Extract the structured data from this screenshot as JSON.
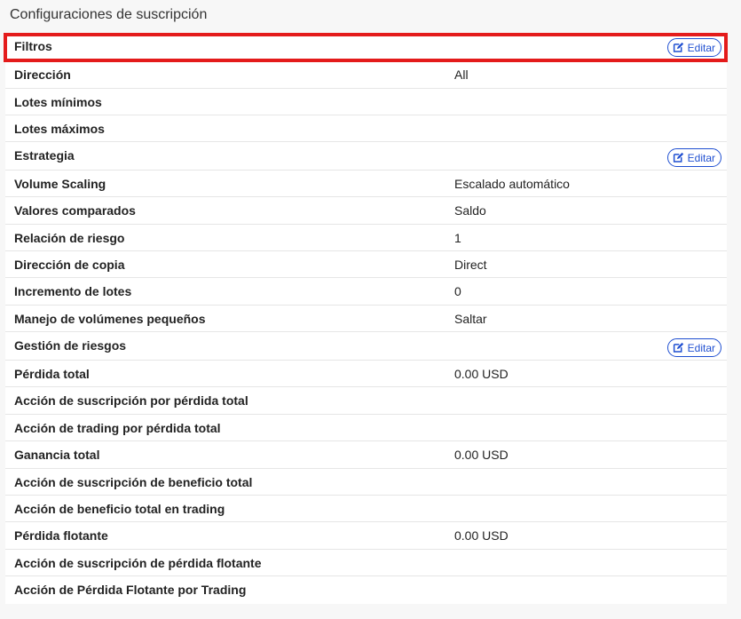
{
  "page": {
    "title": "Configuraciones de suscripción"
  },
  "sections": {
    "filters": {
      "title": "Filtros",
      "edit_label": "Editar",
      "rows": [
        {
          "label": "Dirección",
          "value": "All"
        },
        {
          "label": "Lotes mínimos",
          "value": ""
        },
        {
          "label": "Lotes máximos",
          "value": ""
        }
      ]
    },
    "strategy": {
      "title": "Estrategia",
      "edit_label": "Editar",
      "rows": [
        {
          "label": "Volume Scaling",
          "value": "Escalado automático"
        },
        {
          "label": "Valores comparados",
          "value": "Saldo"
        },
        {
          "label": "Relación de riesgo",
          "value": "1"
        },
        {
          "label": "Dirección de copia",
          "value": "Direct"
        },
        {
          "label": "Incremento de lotes",
          "value": "0"
        },
        {
          "label": "Manejo de volúmenes pequeños",
          "value": "Saltar"
        }
      ]
    },
    "risk": {
      "title": "Gestión de riesgos",
      "edit_label": "Editar",
      "rows": [
        {
          "label": "Pérdida total",
          "value": "0.00 USD"
        },
        {
          "label": "Acción de suscripción por pérdida total",
          "value": ""
        },
        {
          "label": "Acción de trading por pérdida total",
          "value": ""
        },
        {
          "label": "Ganancia total",
          "value": "0.00 USD"
        },
        {
          "label": "Acción de suscripción de beneficio total",
          "value": ""
        },
        {
          "label": "Acción de beneficio total en trading",
          "value": ""
        },
        {
          "label": "Pérdida flotante",
          "value": "0.00 USD"
        },
        {
          "label": "Acción de suscripción de pérdida flotante",
          "value": ""
        },
        {
          "label": "Acción de Pérdida Flotante por Trading",
          "value": ""
        }
      ]
    }
  },
  "colors": {
    "accent": "#1f4fd1",
    "highlight": "#e41b1b",
    "background": "#f7f7f7",
    "panel": "#ffffff"
  },
  "icons": {
    "edit": "pencil-square-icon"
  }
}
